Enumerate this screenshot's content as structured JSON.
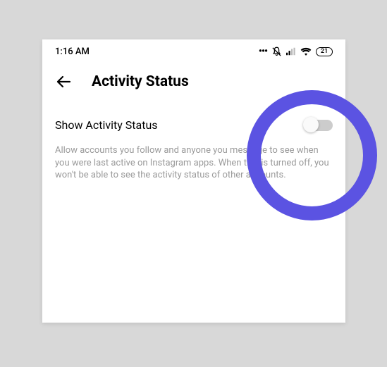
{
  "statusBar": {
    "time": "1:16 AM",
    "battery": "21"
  },
  "header": {
    "title": "Activity Status"
  },
  "setting": {
    "label": "Show Activity Status",
    "description": "Allow accounts you follow and anyone you message to see when you were last active on Instagram apps. When this is turned off, you won't be able to see the activity status of other accounts."
  }
}
